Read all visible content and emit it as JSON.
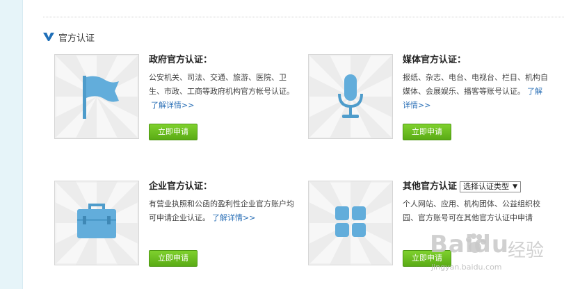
{
  "section": {
    "title": "官方认证",
    "icon": "v-check-icon"
  },
  "cards": [
    {
      "title": "政府官方认证：",
      "desc": "公安机关、司法、交通、旅游、医院、卫生、市政、工商等政府机构官方帐号认证。",
      "link": "了解详情>>",
      "button": "立即申请",
      "icon": "flag-icon"
    },
    {
      "title": "媒体官方认证：",
      "desc": "报纸、杂志、电台、电视台、栏目、机构自媒体、会展娱乐、播客等账号认证。",
      "link": "了解详情>>",
      "button": "立即申请",
      "icon": "microphone-icon"
    },
    {
      "title": "企业官方认证：",
      "desc": "有营业执照和公函的盈利性企业官方账户均可申请企业认证。",
      "link": "了解详情>>",
      "button": "立即申请",
      "icon": "briefcase-icon"
    },
    {
      "title": "其他官方认证",
      "desc": "个人网站、应用、机构团体、公益组织校园、官方账号可在其他官方认证中申请",
      "button": "立即申请",
      "select": "选择认证类型",
      "icon": "grid-icon"
    }
  ],
  "watermark": {
    "brand": "Baidu",
    "cn": "经验",
    "url": "jingyan.baidu.com"
  },
  "colors": {
    "accent": "#1f6fb8",
    "button": "#66b81d",
    "icon": "#4e9ccb"
  }
}
